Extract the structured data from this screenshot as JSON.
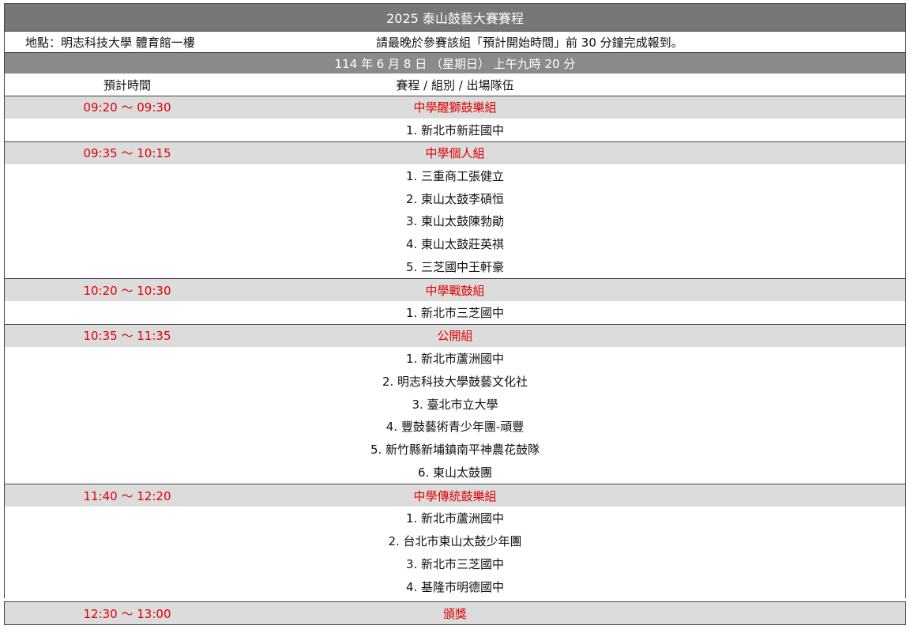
{
  "document": {
    "title": "2025 泰山鼓藝大賽賽程",
    "location": "地點：明志科技大學 體育館一樓",
    "notice": "請最晚於參賽該組「預計開始時間」前 30 分鐘完成報到。",
    "date": "114 年 6 月 8 日 （星期日） 上午九時 20 分",
    "header_time": "預計時間",
    "header_program": "賽程 / 組別 / 出場隊伍"
  },
  "sessions": [
    {
      "time": "09:20 ～ 09:30",
      "group": "中學醒獅鼓樂組",
      "teams": [
        "1. 新北市新莊國中"
      ]
    },
    {
      "time": "09:35 ～ 10:15",
      "group": "中學個人組",
      "teams": [
        "1. 三重商工張健立",
        "2. 東山太鼓李碩恒",
        "3. 東山太鼓陳勃勛",
        "4. 東山太鼓莊英祺",
        "5. 三芝國中王軒豪"
      ]
    },
    {
      "time": "10:20 ～ 10:30",
      "group": "中學戰鼓組",
      "teams": [
        "1. 新北市三芝國中"
      ]
    },
    {
      "time": "10:35 ～ 11:35",
      "group": "公開組",
      "teams": [
        "1. 新北市蘆洲國中",
        "2. 明志科技大學鼓藝文化社",
        "3. 臺北市立大學",
        "4. 豐鼓藝術青少年團-頑豐",
        "5. 新竹縣新埔鎮南平神農花鼓隊",
        "6. 東山太鼓團"
      ]
    },
    {
      "time": "11:40 ～ 12:20",
      "group": "中學傳統鼓樂組",
      "teams": [
        "1. 新北市蘆洲國中",
        "2. 台北市東山太鼓少年團",
        "3. 新北市三芝國中",
        "4. 基隆市明德國中"
      ]
    }
  ],
  "final": {
    "time": "12:30 ～ 13:00",
    "label": "頒獎"
  }
}
